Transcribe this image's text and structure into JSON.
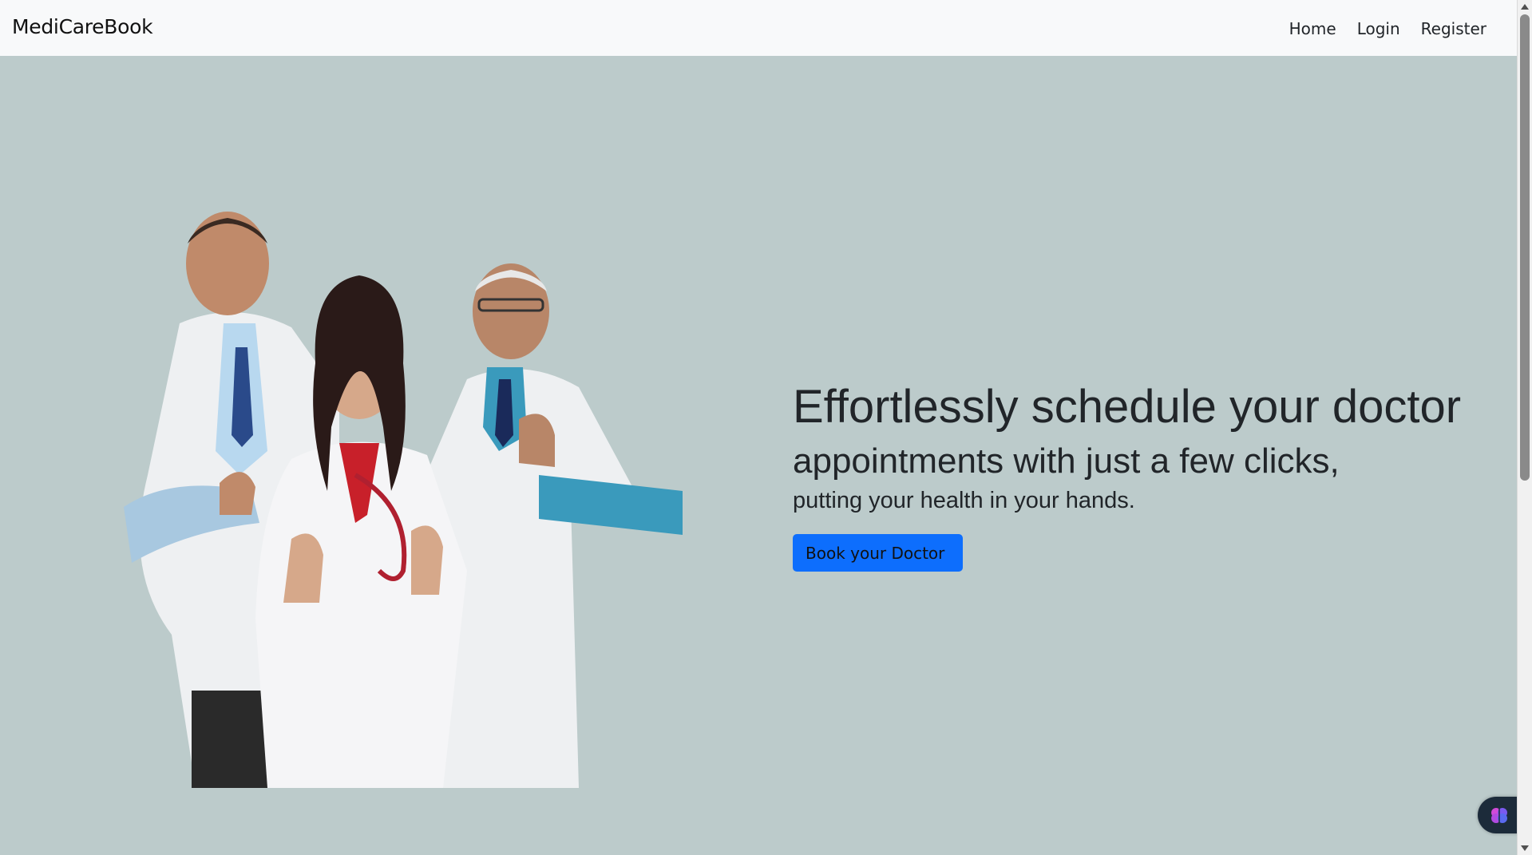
{
  "navbar": {
    "brand": "MediCareBook",
    "links": [
      "Home",
      "Login",
      "Register"
    ]
  },
  "hero": {
    "headline": "Effortlessly schedule your doctor",
    "subheadline": "appointments with just a few clicks,",
    "tagline": "putting your health in your hands.",
    "cta_label": "Book your Doctor"
  },
  "icons": {
    "assistant": "brain-icon"
  },
  "colors": {
    "navbar_bg": "#f8f9fa",
    "hero_bg": "#bccbcb",
    "cta_bg": "#0d6efd"
  }
}
